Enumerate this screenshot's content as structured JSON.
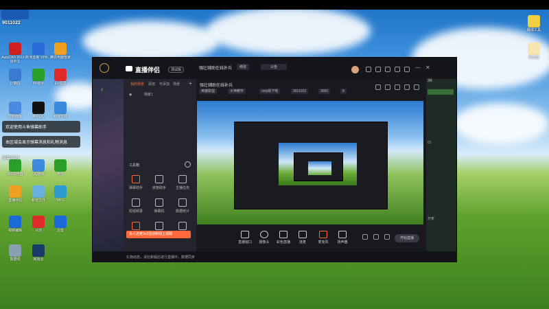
{
  "desktop": {
    "overlay_id": "9011022",
    "notices": [
      "欢迎使用斗鱼弹幕助手",
      "本区域会显示弹幕消息和礼物消息"
    ],
    "notice_tail": "弹幕成功!",
    "icons": [
      {
        "label": "AutoCAD 2010 简体中文",
        "color": "#d02020"
      },
      {
        "label": "米业新 VPN",
        "color": "#2a6ad8"
      },
      {
        "label": "腾讯电脑管家",
        "color": "#f0a020"
      },
      {
        "label": "计算机",
        "color": "#3a7ad0"
      },
      {
        "label": "PP助手",
        "color": "#2aa02a"
      },
      {
        "label": "EV录屏",
        "color": "#e02a2a"
      },
      {
        "label": "控制面板",
        "color": "#4a8ae0"
      },
      {
        "label": "腾讯QQ",
        "color": "#111111"
      },
      {
        "label": "秒速下载",
        "color": "#3a8ae0"
      },
      {
        "label": "360浏览器",
        "color": "#2aa02a"
      },
      {
        "label": "QQ游戏",
        "color": "#3a8ae0"
      },
      {
        "label": "微信",
        "color": "#2aa02a"
      },
      {
        "label": "直播伴侣",
        "color": "#f0a020"
      },
      {
        "label": "新增文件",
        "color": "#6ab0e0"
      },
      {
        "label": "WPS",
        "color": "#2a9ad0"
      },
      {
        "label": "视频编辑",
        "color": "#1a6ad8"
      },
      {
        "label": "从前",
        "color": "#e02a2a"
      },
      {
        "label": "迅雷",
        "color": "#1a6ad8"
      },
      {
        "label": "数据线",
        "color": "#8aa0b0"
      },
      {
        "label": "网易云",
        "color": "#1a3a6a"
      }
    ],
    "right_icons": [
      {
        "label": "翻译工具",
        "color": "#f0d040"
      },
      {
        "label": "新文档",
        "color": "#f5e6b0"
      }
    ]
  },
  "app": {
    "brand": "直播伴侣",
    "beta": "测试版",
    "title": "强壮辅助在线补兵",
    "edit_btn": "修改",
    "announce": "公告",
    "tags": [
      "英雄联盟",
      "大神教学",
      "only殿下呢",
      "9011022",
      "3050",
      "8"
    ],
    "tabs": [
      "我的场景",
      "添加",
      "可添加",
      "场景"
    ],
    "scene_item": "场景1",
    "toolbox_label": "工具箱",
    "tools": [
      {
        "label": "弹幕助手",
        "hot": true
      },
      {
        "label": "房管助手",
        "hot": false
      },
      {
        "label": "主播任务",
        "hot": false
      },
      {
        "label": "短视频录",
        "hot": false
      },
      {
        "label": "弹幕机",
        "hot": false
      },
      {
        "label": "数据统计",
        "hot": false
      },
      {
        "label": "",
        "hot": true
      },
      {
        "label": "",
        "hot": false
      },
      {
        "label": "",
        "hot": false
      }
    ],
    "promo": "多人连麦3v3活动和线上领取",
    "controls": [
      "直播窗口",
      "摄像头",
      "彩色直播",
      "连麦",
      "麦克风",
      "扬声器"
    ],
    "go_live": "开始直播",
    "status": "礼物动态，请在新版后进行直播中，数据同步",
    "right_panel_texts": [
      "36",
      "01",
      "开麦",
      "3"
    ]
  },
  "colors": {
    "accent": "#ff6a3d"
  }
}
